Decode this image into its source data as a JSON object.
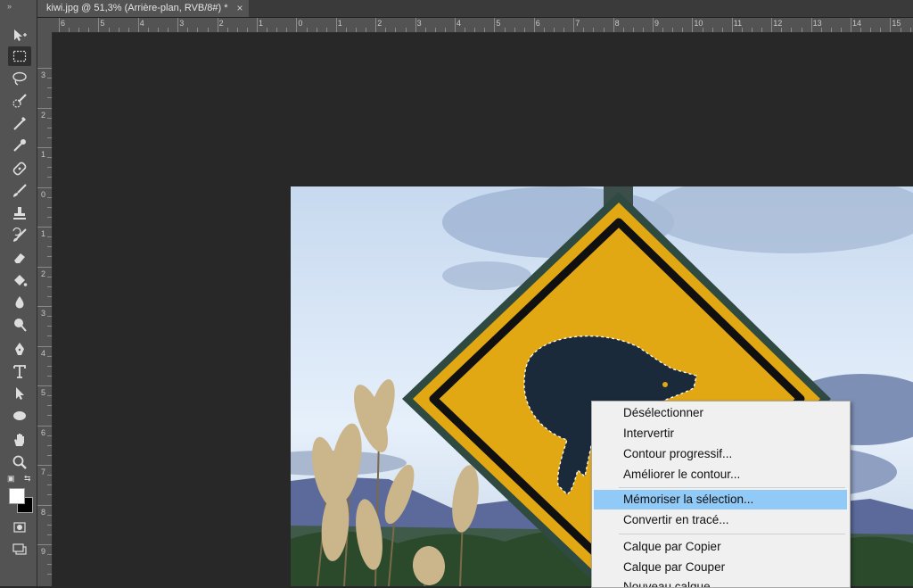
{
  "document_tab": {
    "title": "kiwi.jpg @ 51,3% (Arrière-plan, RVB/8#) *",
    "close": "×"
  },
  "ruler": {
    "h_labels": [
      "6",
      "5",
      "4",
      "3",
      "2",
      "1",
      "0",
      "1",
      "2",
      "3",
      "4",
      "5",
      "6",
      "7",
      "8",
      "9",
      "10",
      "11",
      "12",
      "13",
      "14",
      "15"
    ],
    "v_labels": [
      "3",
      "2",
      "1",
      "0",
      "1",
      "2",
      "3",
      "4",
      "5",
      "6",
      "7",
      "8",
      "9"
    ]
  },
  "toolbar": {
    "tools": [
      "move-icon",
      "rectangular-marquee-icon",
      "lasso-icon",
      "quick-selection-icon",
      "crop-icon",
      "eyedropper-icon",
      "spot-healing-brush-icon",
      "brush-icon",
      "clone-stamp-icon",
      "history-brush-icon",
      "eraser-icon",
      "paint-bucket-icon",
      "blur-icon",
      "dodge-icon",
      "pen-icon",
      "type-icon",
      "path-selection-icon",
      "ellipse-icon",
      "hand-icon",
      "zoom-icon"
    ],
    "active_tool": "rectangular-marquee-icon",
    "foreground_color": "#ffffff",
    "background_color": "#000000"
  },
  "context_menu": {
    "items": [
      {
        "label": "Désélectionner"
      },
      {
        "label": "Intervertir"
      },
      {
        "label": "Contour progressif..."
      },
      {
        "label": "Améliorer le contour..."
      },
      {
        "label": "Mémoriser la sélection...",
        "highlighted": true
      },
      {
        "label": "Convertir en tracé..."
      },
      {
        "label": "Calque par Copier"
      },
      {
        "label": "Calque par Couper"
      },
      {
        "label": "Nouveau calque..."
      }
    ]
  }
}
